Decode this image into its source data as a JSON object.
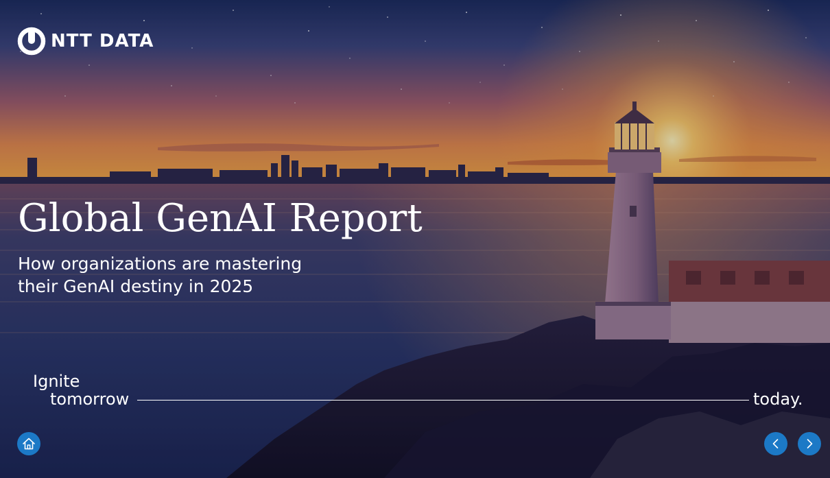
{
  "brand": {
    "logo_text": "NTT DATA"
  },
  "hero": {
    "title": "Global GenAI Report",
    "subtitle_line1": "How organizations are mastering",
    "subtitle_line2": "their GenAI destiny in 2025"
  },
  "tagline": {
    "line1": "Ignite",
    "line2": "tomorrow",
    "line3": "today."
  },
  "navigation": {
    "home_icon": "home-icon",
    "prev_icon": "chevron-left-icon",
    "next_icon": "chevron-right-icon"
  },
  "colors": {
    "nav_button": "#1c79c6",
    "text": "#ffffff"
  }
}
